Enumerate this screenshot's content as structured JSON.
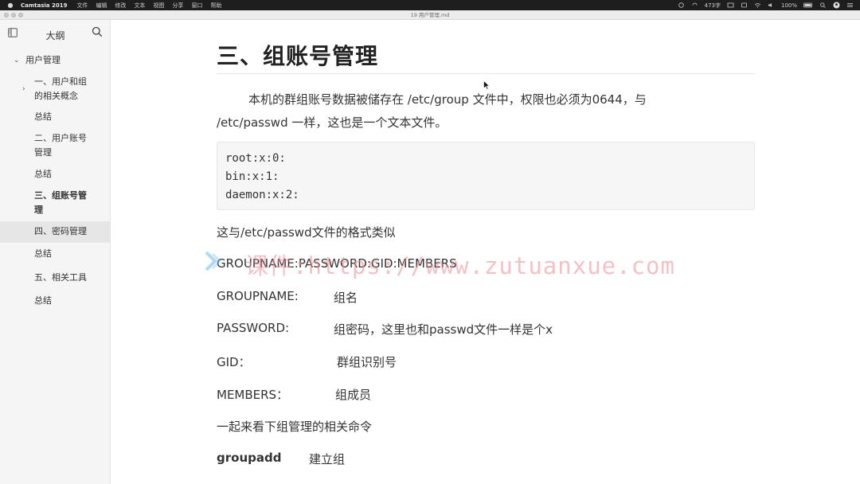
{
  "menubar": {
    "app_name": "Camtasia 2019",
    "items": [
      "文件",
      "编辑",
      "修改",
      "文本",
      "视图",
      "分享",
      "窗口",
      "帮助"
    ],
    "status": {
      "count": "473字",
      "battery": "100%"
    }
  },
  "window": {
    "title": "19 用户管理.md"
  },
  "sidebar": {
    "title": "大纲",
    "items": [
      {
        "label": "用户管理"
      },
      {
        "label_l1": "一、用户和组",
        "label_l2": "的相关概念"
      },
      {
        "label": "总结"
      },
      {
        "label_l1": "二、用户账号",
        "label_l2": "管理"
      },
      {
        "label": "总结"
      },
      {
        "label_l1": "三、组账号管",
        "label_l2": "理"
      },
      {
        "label": "四、密码管理"
      },
      {
        "label": "总结"
      },
      {
        "label": "五、相关工具"
      },
      {
        "label": "总结"
      }
    ]
  },
  "content": {
    "heading": "三、组账号管理",
    "intro_l1": "本机的群组账号数据被储存在 /etc/group 文件中，权限也必须为0644，与",
    "intro_l2": "/etc/passwd 一样，这也是一个文本文件。",
    "code_lines": [
      "root:x:0:",
      "bin:x:1:",
      "daemon:x:2:"
    ],
    "similar": "这与/etc/passwd文件的格式类似",
    "format": "GROUPNAME:PASSWORD:GID:MEMBERS",
    "fields": [
      {
        "key": "GROUPNAME:",
        "value": "组名"
      },
      {
        "key": "PASSWORD:",
        "value": "组密码，这里也和passwd文件一样是个x"
      },
      {
        "key": "GID：",
        "value": "群组识别号"
      },
      {
        "key": "MEMBERS：",
        "value": "组成员"
      }
    ],
    "lead": "一起来看下组管理的相关命令",
    "cmd": {
      "name": "groupadd",
      "desc": "建立组"
    }
  },
  "watermark": {
    "text": "课件:https://www.zutuanxue.com"
  }
}
